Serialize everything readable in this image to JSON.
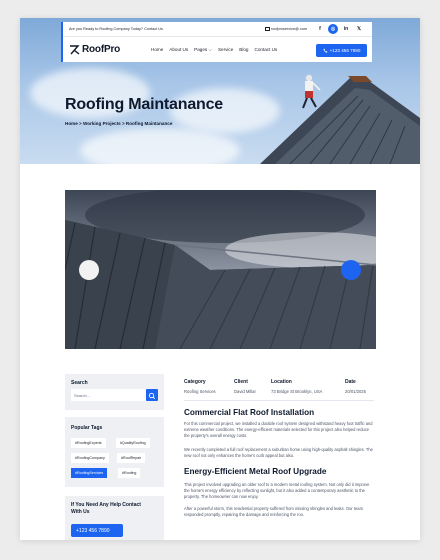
{
  "topbar": {
    "promo": "Are you Ready to Roofing Company Today?  Contact Us",
    "email": "roofproservice@.com",
    "socials": [
      {
        "icon": "facebook-icon",
        "label": "f"
      },
      {
        "icon": "instagram-icon",
        "label": "◎"
      },
      {
        "icon": "linkedin-icon",
        "label": "in"
      },
      {
        "icon": "x-icon",
        "label": "𝕏"
      }
    ]
  },
  "nav": {
    "logo": "RoofPro",
    "items": [
      "Home",
      "About Us",
      "Pages ⌵",
      "Service",
      "Blog",
      "Contact Us"
    ],
    "phone": "+123 456 7890"
  },
  "hero": {
    "title": "Roofing Maintanance",
    "breadcrumb": "Home > Working Projects > Roofing Maintanance"
  },
  "colors": {
    "accent": "#1d64f0",
    "dark": "#0f1a2e",
    "sidebar_bg": "#eef0f4"
  },
  "sidebar": {
    "search_title": "Search",
    "search_placeholder": "Search...",
    "tags_title": "Popular Tags",
    "tags": [
      {
        "label": "#RoofingExperts",
        "active": false
      },
      {
        "label": "#QualityRoofing",
        "active": false
      },
      {
        "label": "#RoofingCompany",
        "active": false
      },
      {
        "label": "#RoofRepair",
        "active": false
      },
      {
        "label": "#RoofingServices",
        "active": true
      },
      {
        "label": "#Roofing",
        "active": false
      }
    ],
    "help_title": "If You Need Any Help Contact With Us",
    "help_phone": "+123 456 7890"
  },
  "project": {
    "info": [
      {
        "label": "Category",
        "value": "Roofing Services"
      },
      {
        "label": "Client",
        "value": "David Millar"
      },
      {
        "label": "Location",
        "value": "73 Bridge St Brooklyn, USA"
      },
      {
        "label": "Date",
        "value": "20/01/2025"
      }
    ],
    "section1_title": "Commercial Flat Roof Installation",
    "section1_p1": "For this commercial project, we installed a durable roof system designed withstand heavy foot traffic and extreme weather conditions. The energy-efficient materials selected for this project also helped reduce the property's overall energy costs.",
    "section1_p2": "We recently completed a full roof replacement a suburban home using high-quality asphalt shingles. The new roof not only enhances the home's curb appeal but also.",
    "section2_title": "Energy-Efficient Metal Roof Upgrade",
    "section2_p1": "This project involved upgrading an older roof to a modern metal roofing system. Not only did it improve the home's energy efficiency by reflecting sunlight, but it also added a contemporary aesthetic to the property. The homeowner can now enjoy.",
    "section2_p2": "After a powerful storm, this residential property suffered from missing shingles and leaks. Our team responded promptly, repairing the damage and reinforcing the roo."
  }
}
